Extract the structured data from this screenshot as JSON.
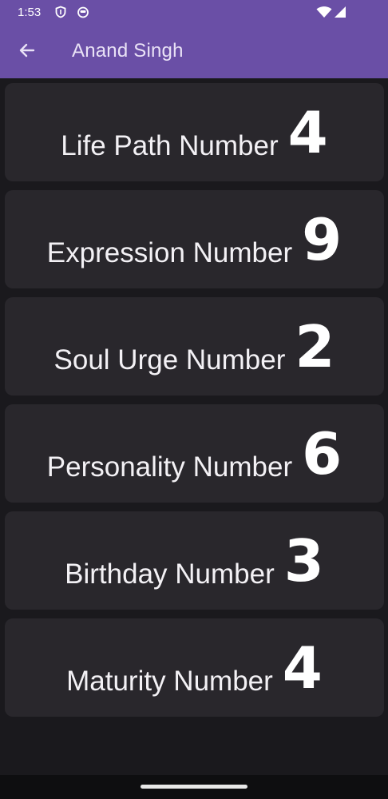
{
  "status_bar": {
    "time": "1:53",
    "icons": [
      "shield-icon",
      "cat-face-icon",
      "wifi-icon",
      "cellular-signal-icon"
    ]
  },
  "app_bar": {
    "title": "Anand Singh",
    "back_icon": "arrow-back-icon"
  },
  "cards": [
    {
      "label": "Life Path Number",
      "value": "4"
    },
    {
      "label": "Expression Number",
      "value": "9"
    },
    {
      "label": "Soul Urge Number",
      "value": "2"
    },
    {
      "label": "Personality Number",
      "value": "6"
    },
    {
      "label": "Birthday Number",
      "value": "3"
    },
    {
      "label": "Maturity Number",
      "value": "4"
    }
  ],
  "colors": {
    "app_bar": "#6a4fa6",
    "background": "#1a191d",
    "card": "#29272c",
    "text": "#ffffff"
  }
}
